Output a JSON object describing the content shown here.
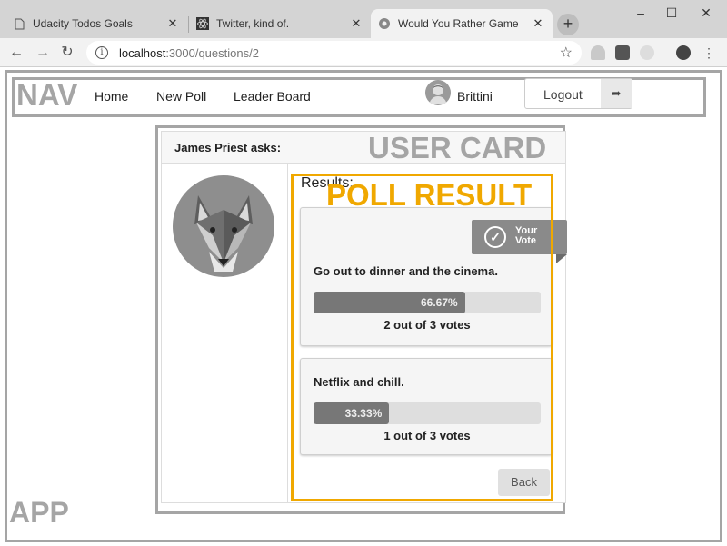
{
  "browser": {
    "tabs": [
      {
        "title": "Udacity Todos Goals",
        "icon": "page-icon"
      },
      {
        "title": "Twitter, kind of.",
        "icon": "react-icon"
      },
      {
        "title": "Would You Rather Game",
        "icon": "globe-icon"
      }
    ],
    "url_host": "localhost",
    "url_path": ":3000/questions/2"
  },
  "annotations": {
    "nav": "NAV",
    "user_card": "USER CARD",
    "poll_result": "POLL RESULT",
    "app": "APP",
    "poll_color": "#f0a800",
    "box_color": "#a5a5a5"
  },
  "nav": {
    "home": "Home",
    "new_poll": "New Poll",
    "leader_board": "Leader Board",
    "user_name": "Brittini",
    "logout": "Logout"
  },
  "card": {
    "asker": "James Priest asks:",
    "results_title": "Results:",
    "your_vote": [
      "Your",
      "Vote"
    ],
    "options": [
      {
        "text": "Go out to dinner and the cinema.",
        "percent_label": "66.67%",
        "percent": 66.67,
        "votes": "2 out of 3 votes",
        "user_vote": true
      },
      {
        "text": "Netflix and chill.",
        "percent_label": "33.33%",
        "percent": 33.33,
        "votes": "1 out of 3 votes",
        "user_vote": false
      }
    ],
    "back": "Back"
  }
}
